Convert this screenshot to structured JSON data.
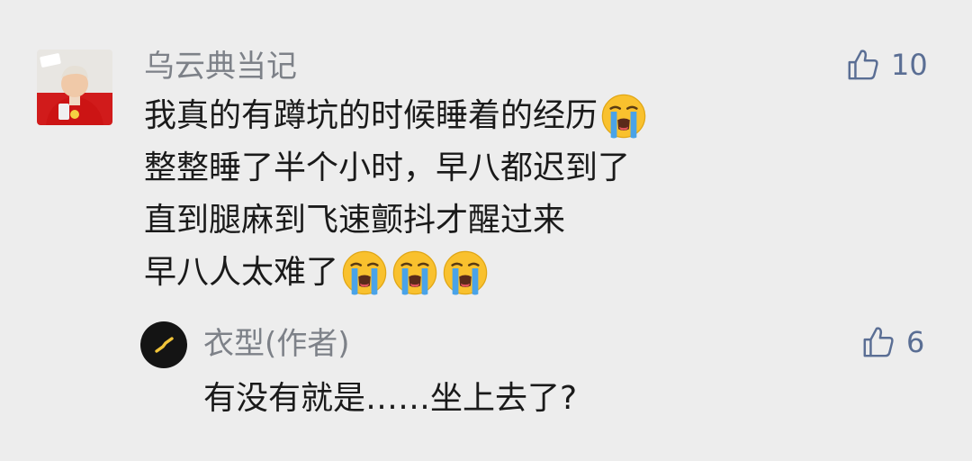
{
  "comment": {
    "username": "乌云典当记",
    "like_count": "10",
    "lines": [
      "我真的有蹲坑的时候睡着的经历",
      "整整睡了半个小时，早八都迟到了",
      "直到腿麻到飞速颤抖才醒过来",
      "早八人太难了"
    ],
    "emoji_name": "loudly-crying-face"
  },
  "reply": {
    "username": "衣型(作者)",
    "like_count": "6",
    "text": "有没有就是……坐上去了?"
  },
  "colors": {
    "background": "#ededed",
    "name_text": "#7d8188",
    "body_text": "#1a1a1a",
    "like_accent": "#5a6e94",
    "emoji_face": "#f9c12e",
    "emoji_tears": "#4aa3e8"
  },
  "icons": {
    "like": "thumbs-up-icon",
    "avatar_main": "user-avatar-photo",
    "avatar_reply": "author-logo-avatar"
  }
}
